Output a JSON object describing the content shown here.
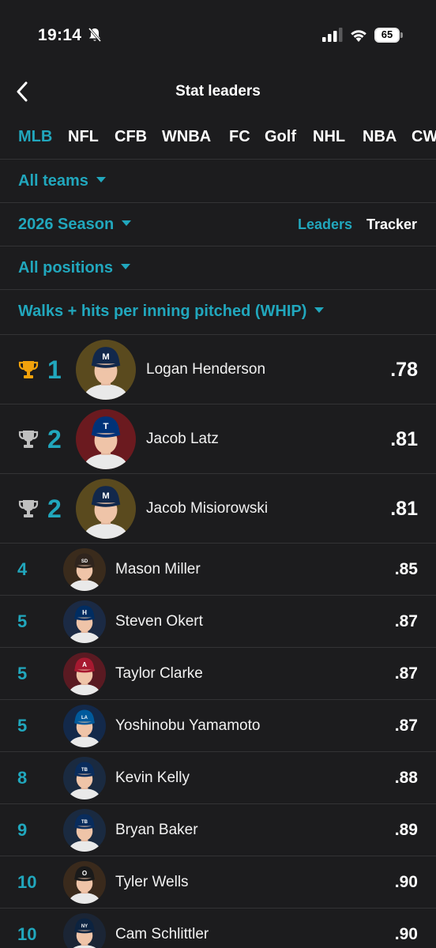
{
  "status_bar": {
    "time": "19:14",
    "battery": "65"
  },
  "header": {
    "title": "Stat leaders"
  },
  "league_tabs": [
    "MLB",
    "NFL",
    "CFB",
    "WNBA",
    "FC",
    "Golf",
    "NHL",
    "NBA",
    "CW"
  ],
  "active_league": "MLB",
  "filters": {
    "team": "All teams",
    "season": "2026 Season",
    "view_leaders": "Leaders",
    "view_tracker": "Tracker",
    "position": "All positions",
    "stat": "Walks + hits per inning pitched (WHIP)"
  },
  "colors": {
    "accent": "#21a7bd",
    "gold_trophy": "#f2a20c",
    "silver_trophy": "#bfbfbf"
  },
  "leaders": [
    {
      "rank": "1",
      "name": "Logan Henderson",
      "value": ".78",
      "trophy": "gold",
      "team_color": "#5a4a1e",
      "cap_color": "#12284b",
      "logo": "M"
    },
    {
      "rank": "2",
      "name": "Jacob Latz",
      "value": ".81",
      "trophy": "silver",
      "team_color": "#6b1a1f",
      "cap_color": "#003278",
      "logo": "T"
    },
    {
      "rank": "2",
      "name": "Jacob Misiorowski",
      "value": ".81",
      "trophy": "silver",
      "team_color": "#5a4a1e",
      "cap_color": "#12284b",
      "logo": "M"
    },
    {
      "rank": "4",
      "name": "Mason Miller",
      "value": ".85",
      "trophy": "",
      "team_color": "#3a2b1c",
      "cap_color": "#2f241d",
      "logo": "SD"
    },
    {
      "rank": "5",
      "name": "Steven Okert",
      "value": ".87",
      "trophy": "",
      "team_color": "#1b2a44",
      "cap_color": "#002d62",
      "logo": "H"
    },
    {
      "rank": "5",
      "name": "Taylor Clarke",
      "value": ".87",
      "trophy": "",
      "team_color": "#5a1a22",
      "cap_color": "#a71930",
      "logo": "A"
    },
    {
      "rank": "5",
      "name": "Yoshinobu Yamamoto",
      "value": ".87",
      "trophy": "",
      "team_color": "#13294a",
      "cap_color": "#005a9c",
      "logo": "LA"
    },
    {
      "rank": "8",
      "name": "Kevin Kelly",
      "value": ".88",
      "trophy": "",
      "team_color": "#1a2a40",
      "cap_color": "#092c5c",
      "logo": "TB"
    },
    {
      "rank": "9",
      "name": "Bryan Baker",
      "value": ".89",
      "trophy": "",
      "team_color": "#1a2a40",
      "cap_color": "#092c5c",
      "logo": "TB"
    },
    {
      "rank": "10",
      "name": "Tyler Wells",
      "value": ".90",
      "trophy": "",
      "team_color": "#3a2a1c",
      "cap_color": "#1a1a1a",
      "logo": "O"
    },
    {
      "rank": "10",
      "name": "Cam Schlittler",
      "value": ".90",
      "trophy": "",
      "team_color": "#1b2535",
      "cap_color": "#0c2340",
      "logo": "NY"
    }
  ]
}
